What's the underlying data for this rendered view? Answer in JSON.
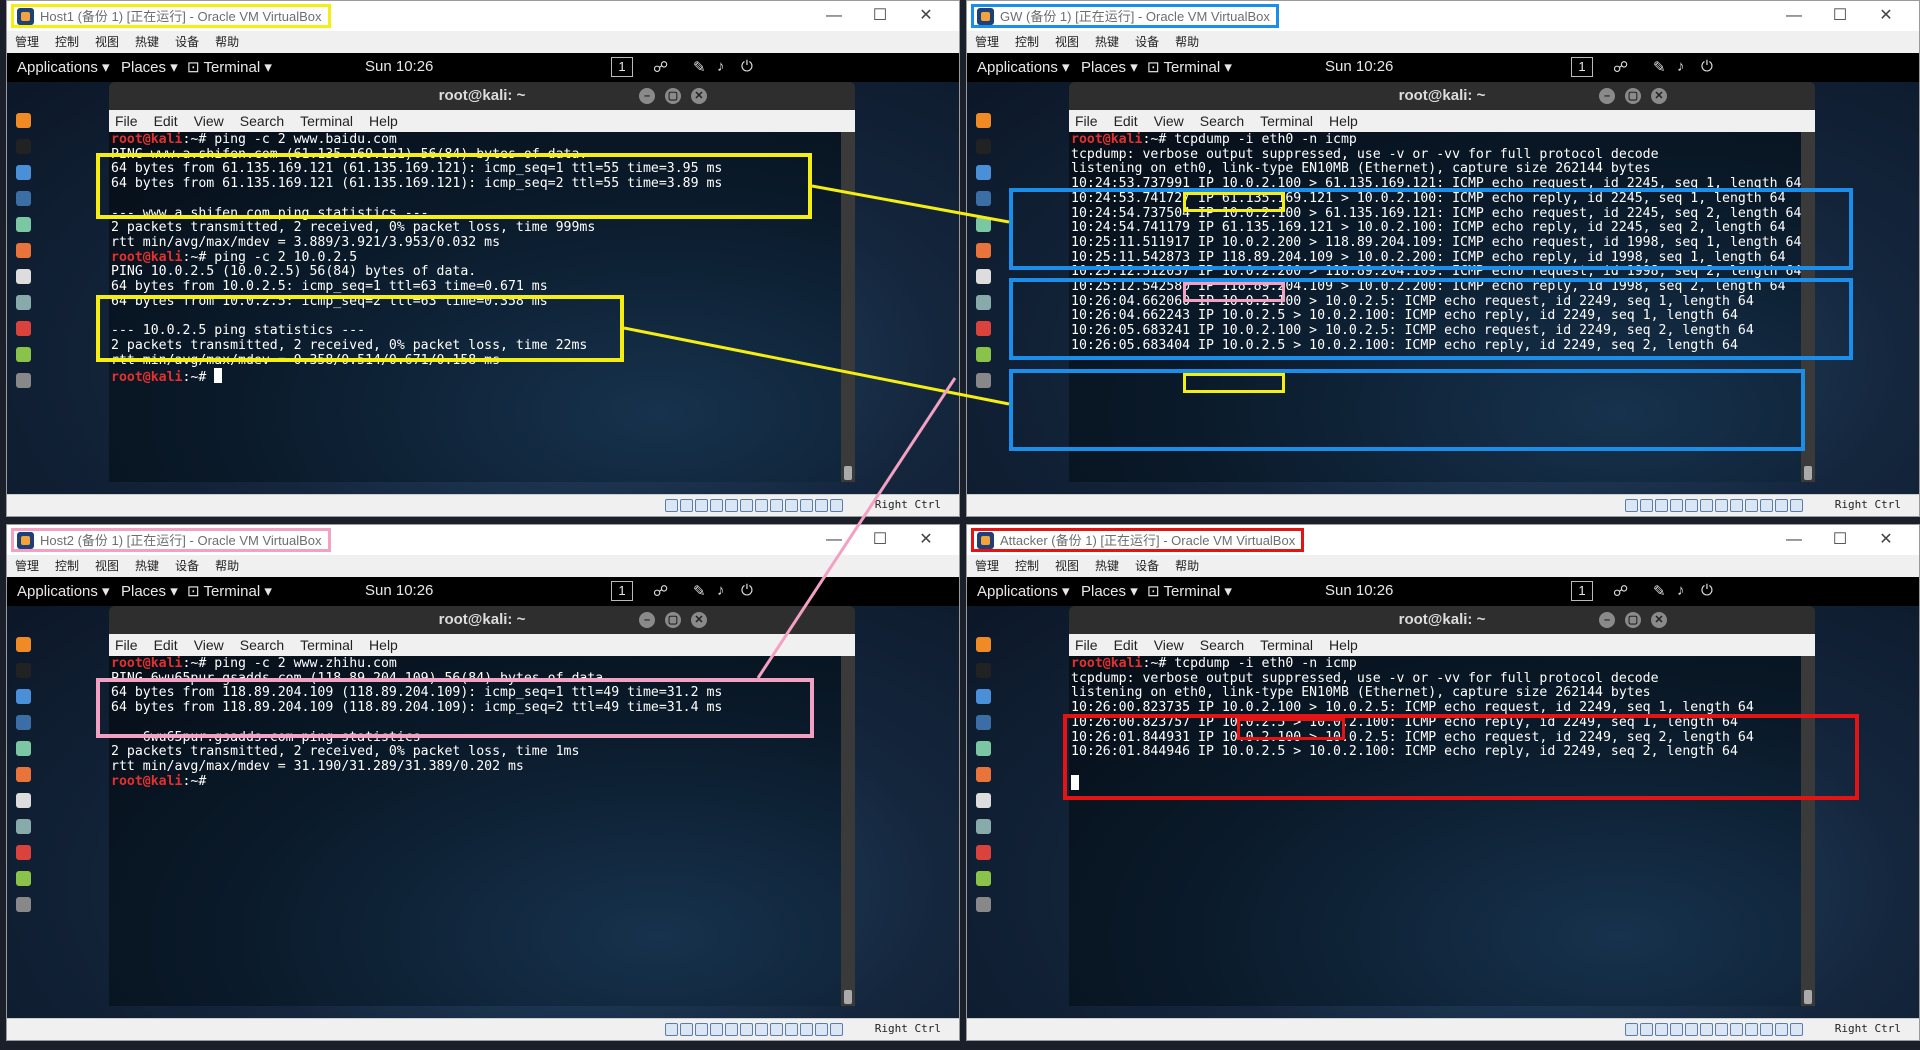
{
  "vm_menu": [
    "管理",
    "控制",
    "视图",
    "热键",
    "设备",
    "帮助"
  ],
  "gnome": {
    "applications": "Applications ▾",
    "places": "Places ▾",
    "terminal": "Terminal ▾",
    "clock": "Sun 10:26",
    "workspace": "1"
  },
  "terminal_title": "root@kali: ~",
  "terminal_menu": [
    "File",
    "Edit",
    "View",
    "Search",
    "Terminal",
    "Help"
  ],
  "status_host_key": "Right Ctrl",
  "colors": {
    "yellow": "#f5ee12",
    "blue": "#1a8ee8",
    "pink": "#f3a1c2",
    "red": "#e41414",
    "prompt": "#e53030"
  },
  "windows": {
    "host1": {
      "title": "Host1 (备份 1) [正在运行] - Oracle VM VirtualBox",
      "highlight": "yellow",
      "lines": [
        {
          "p": "root@kali",
          "t": ":~# ping -c 2 www.baidu.com"
        },
        {
          "t": "PING www.a.shifen.com (61.135.169.121) 56(84) bytes of data."
        },
        {
          "t": "64 bytes from 61.135.169.121 (61.135.169.121): icmp_seq=1 ttl=55 time=3.95 ms"
        },
        {
          "t": "64 bytes from 61.135.169.121 (61.135.169.121): icmp_seq=2 ttl=55 time=3.89 ms"
        },
        {
          "t": ""
        },
        {
          "t": "--- www.a.shifen.com ping statistics ---"
        },
        {
          "t": "2 packets transmitted, 2 received, 0% packet loss, time 999ms"
        },
        {
          "t": "rtt min/avg/max/mdev = 3.889/3.921/3.953/0.032 ms"
        },
        {
          "p": "root@kali",
          "t": ":~# ping -c 2 10.0.2.5"
        },
        {
          "t": "PING 10.0.2.5 (10.0.2.5) 56(84) bytes of data."
        },
        {
          "t": "64 bytes from 10.0.2.5: icmp_seq=1 ttl=63 time=0.671 ms"
        },
        {
          "t": "64 bytes from 10.0.2.5: icmp_seq=2 ttl=63 time=0.358 ms"
        },
        {
          "t": ""
        },
        {
          "t": "--- 10.0.2.5 ping statistics ---"
        },
        {
          "t": "2 packets transmitted, 2 received, 0% packet loss, time 22ms"
        },
        {
          "t": "rtt min/avg/max/mdev = 0.358/0.514/0.671/0.158 ms"
        },
        {
          "p": "root@kali",
          "t": ":~# ",
          "cursor": true
        }
      ]
    },
    "gw": {
      "title": "GW (备份 1) [正在运行] - Oracle VM VirtualBox",
      "highlight": "blue",
      "lines": [
        {
          "p": "root@kali",
          "t": ":~# tcpdump -i eth0 -n icmp"
        },
        {
          "t": "tcpdump: verbose output suppressed, use -v or -vv for full protocol decode"
        },
        {
          "t": "listening on eth0, link-type EN10MB (Ethernet), capture size 262144 bytes"
        },
        {
          "t": "10:24:53.737991 IP 10.0.2.100 > 61.135.169.121: ICMP echo request, id 2245, seq 1, length 64"
        },
        {
          "t": "10:24:53.741727 IP 61.135.169.121 > 10.0.2.100: ICMP echo reply, id 2245, seq 1, length 64"
        },
        {
          "t": "10:24:54.737504 IP 10.0.2.100 > 61.135.169.121: ICMP echo request, id 2245, seq 2, length 64"
        },
        {
          "t": "10:24:54.741179 IP 61.135.169.121 > 10.0.2.100: ICMP echo reply, id 2245, seq 2, length 64"
        },
        {
          "t": "10:25:11.511917 IP 10.0.2.200 > 118.89.204.109: ICMP echo request, id 1998, seq 1, length 64"
        },
        {
          "t": "10:25:11.542873 IP 118.89.204.109 > 10.0.2.200: ICMP echo reply, id 1998, seq 1, length 64"
        },
        {
          "t": "10:25:12.512037 IP 10.0.2.200 > 118.89.204.109: ICMP echo request, id 1998, seq 2, length 64"
        },
        {
          "t": "10:25:12.542580 IP 118.89.204.109 > 10.0.2.200: ICMP echo reply, id 1998, seq 2, length 64"
        },
        {
          "t": "10:26:04.662060 IP 10.0.2.100 > 10.0.2.5: ICMP echo request, id 2249, seq 1, length 64"
        },
        {
          "t": "10:26:04.662243 IP 10.0.2.5 > 10.0.2.100: ICMP echo reply, id 2249, seq 1, length 64"
        },
        {
          "t": "10:26:05.683241 IP 10.0.2.100 > 10.0.2.5: ICMP echo request, id 2249, seq 2, length 64"
        },
        {
          "t": "10:26:05.683404 IP 10.0.2.5 > 10.0.2.100: ICMP echo reply, id 2249, seq 2, length 64"
        }
      ]
    },
    "host2": {
      "title": "Host2 (备份 1) [正在运行] - Oracle VM VirtualBox",
      "highlight": "pink",
      "lines": [
        {
          "p": "root@kali",
          "t": ":~# ping -c 2 www.zhihu.com"
        },
        {
          "t": "PING 6wu65pur.gsadds.com (118.89.204.109) 56(84) bytes of data."
        },
        {
          "t": "64 bytes from 118.89.204.109 (118.89.204.109): icmp_seq=1 ttl=49 time=31.2 ms"
        },
        {
          "t": "64 bytes from 118.89.204.109 (118.89.204.109): icmp_seq=2 ttl=49 time=31.4 ms"
        },
        {
          "t": ""
        },
        {
          "t": "--- 6wu65pur.gsadds.com ping statistics ---"
        },
        {
          "t": "2 packets transmitted, 2 received, 0% packet loss, time 1ms"
        },
        {
          "t": "rtt min/avg/max/mdev = 31.190/31.289/31.389/0.202 ms"
        },
        {
          "p": "root@kali",
          "t": ":~# "
        }
      ]
    },
    "attacker": {
      "title": "Attacker (备份 1) [正在运行] - Oracle VM VirtualBox",
      "highlight": "red",
      "lines": [
        {
          "p": "root@kali",
          "t": ":~# tcpdump -i eth0 -n icmp"
        },
        {
          "t": "tcpdump: verbose output suppressed, use -v or -vv for full protocol decode"
        },
        {
          "t": "listening on eth0, link-type EN10MB (Ethernet), capture size 262144 bytes"
        },
        {
          "t": "10:26:00.823735 IP 10.0.2.100 > 10.0.2.5: ICMP echo request, id 2249, seq 1, length 64"
        },
        {
          "t": "10:26:00.823757 IP 10.0.2.5 > 10.0.2.100: ICMP echo reply, id 2249, seq 1, length 64"
        },
        {
          "t": "10:26:01.844931 IP 10.0.2.100 > 10.0.2.5: ICMP echo request, id 2249, seq 2, length 64"
        },
        {
          "t": "10:26:01.844946 IP 10.0.2.5 > 10.0.2.100: ICMP echo reply, id 2249, seq 2, length 64"
        },
        {
          "t": ""
        },
        {
          "t": "",
          "cursor": true
        }
      ]
    }
  }
}
